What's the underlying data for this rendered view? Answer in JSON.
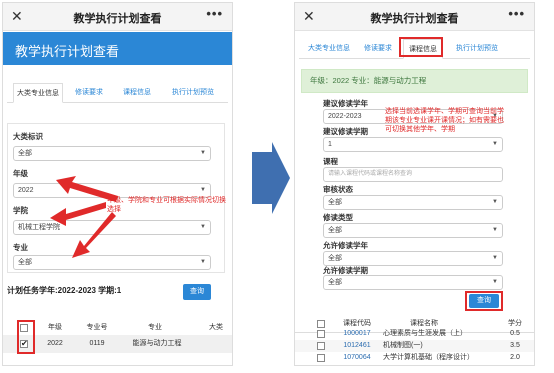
{
  "common": {
    "app_title": "教学执行计划查看",
    "close_glyph": "✕",
    "more_glyph": "•••"
  },
  "left": {
    "header": "教学执行计划查看",
    "tabs": [
      "大类专业信息",
      "修读要求",
      "课程信息",
      "执行计划预览"
    ],
    "fields": {
      "category_label": "大类标识",
      "category_value": "全部",
      "grade_label": "年级",
      "grade_value": "2022",
      "college_label": "学院",
      "college_value": "机械工程学院",
      "major_label": "专业",
      "major_value": "全部"
    },
    "annotation": "年级、学院和专业可根据实际情况切换选择",
    "task_line": "计划任务学年:2022-2023 学期:1",
    "query_button": "查询",
    "table_headers": [
      "",
      "年级",
      "专业号",
      "专业",
      "大类"
    ],
    "table_row": [
      "2022",
      "0119",
      "能源与动力工程"
    ]
  },
  "right": {
    "tabs": [
      "大类专业信息",
      "修读要求",
      "课程信息",
      "执行计划预览"
    ],
    "banner": "年级：2022 专业：能源与动力工程",
    "fields": {
      "year_label": "建议修读学年",
      "year_value": "2022-2023",
      "term_label": "建议修读学期",
      "term_value": "1",
      "course_label": "课程",
      "course_placeholder": "请输入课程代码或课程名称查询",
      "audit_label": "审核状态",
      "audit_value": "全部",
      "type_label": "修读类型",
      "type_value": "全部",
      "allow_year_label": "允许修读学年",
      "allow_year_value": "全部",
      "allow_term_label": "允许修读学期",
      "allow_term_value": "全部"
    },
    "annotation": "选择当前选课学年、学期可查询当前学期该专业专业课开课情况；如有需要也可切换其他学年、学期",
    "query_button": "查询",
    "table_headers": [
      "",
      "课程代码",
      "课程名称",
      "学分"
    ],
    "rows": [
      [
        "1000017",
        "心理素质与生涯发展（上）",
        "0.5"
      ],
      [
        "1012461",
        "机械制图(一)",
        "3.5"
      ],
      [
        "1070064",
        "大学计算机基础（程序设计）",
        "2.0"
      ]
    ]
  },
  "colors": {
    "accent": "#2b87d6",
    "annotation": "#e02a2a",
    "banner_bg": "#dff0d8",
    "arrow": "#3f6fb0"
  }
}
